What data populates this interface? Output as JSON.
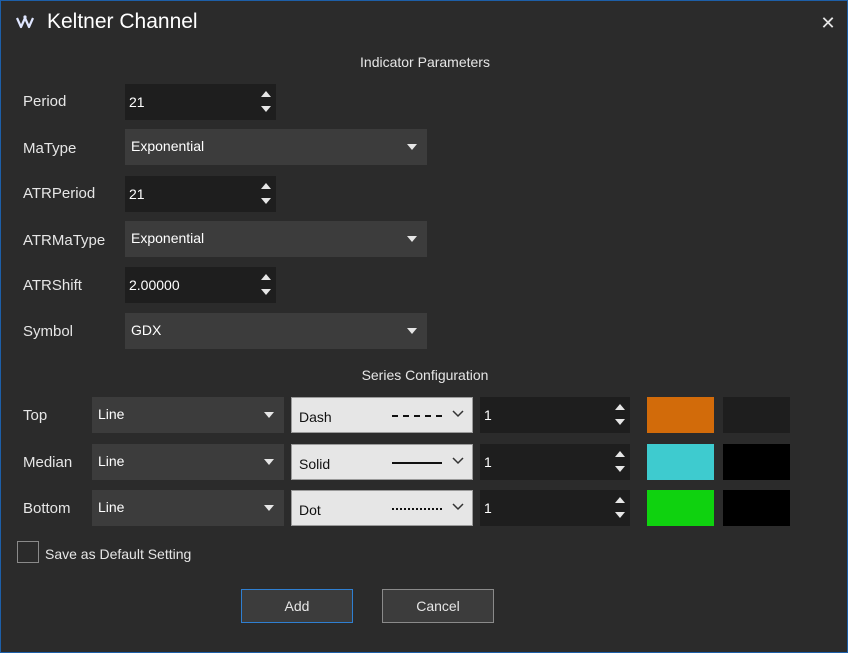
{
  "dialog": {
    "title": "Keltner Channel",
    "close_symbol": "✕",
    "icon": "keltner-logo-icon"
  },
  "indicator": {
    "section_title": "Indicator Parameters",
    "period": {
      "label": "Period",
      "value": "21"
    },
    "matype": {
      "label": "MaType",
      "value": "Exponential"
    },
    "atrperiod": {
      "label": "ATRPeriod",
      "value": "21"
    },
    "atrmatype": {
      "label": "ATRMaType",
      "value": "Exponential"
    },
    "atrshift": {
      "label": "ATRShift",
      "value": "2.00000"
    },
    "symbol": {
      "label": "Symbol",
      "value": "GDX"
    }
  },
  "series": {
    "section_title": "Series Configuration",
    "rows": [
      {
        "label": "Top",
        "type": "Line",
        "style": "Dash",
        "width": "1",
        "color": "#d26b0a",
        "bg": "#1e1e1e"
      },
      {
        "label": "Median",
        "type": "Line",
        "style": "Solid",
        "width": "1",
        "color": "#3ecbcf",
        "bg": "#000000"
      },
      {
        "label": "Bottom",
        "type": "Line",
        "style": "Dot",
        "width": "1",
        "color": "#0fd20f",
        "bg": "#000000"
      }
    ]
  },
  "save_default": {
    "label": "Save as Default Setting",
    "checked": false
  },
  "buttons": {
    "add": "Add",
    "cancel": "Cancel"
  }
}
